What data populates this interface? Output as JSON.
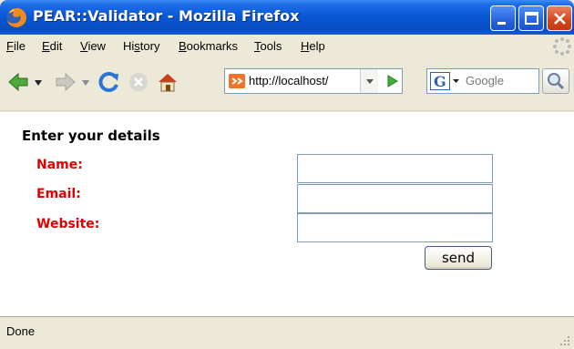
{
  "window": {
    "title": "PEAR::Validator - Mozilla Firefox"
  },
  "menu": [
    {
      "label": "File",
      "accel": "F",
      "rest": "ile"
    },
    {
      "label": "Edit",
      "accel": "E",
      "rest": "dit"
    },
    {
      "label": "View",
      "accel": "V",
      "rest": "iew"
    },
    {
      "label": "History",
      "pre": "Hi",
      "accel": "s",
      "rest": "tory"
    },
    {
      "label": "Bookmarks",
      "accel": "B",
      "rest": "ookmarks"
    },
    {
      "label": "Tools",
      "accel": "T",
      "rest": "ools"
    },
    {
      "label": "Help",
      "accel": "H",
      "rest": "elp"
    }
  ],
  "toolbar": {
    "url": "http://localhost/",
    "search_placeholder": "Google",
    "icons": [
      "back-icon",
      "forward-icon",
      "reload-icon",
      "stop-icon",
      "home-icon",
      "go-icon",
      "search-engine-icon",
      "magnifier-icon"
    ]
  },
  "form": {
    "heading": "Enter your details",
    "fields": [
      {
        "label": "Name:",
        "value": ""
      },
      {
        "label": "Email:",
        "value": ""
      },
      {
        "label": "Website:",
        "value": ""
      }
    ],
    "submit_label": "send",
    "label_color": "#e00000"
  },
  "status": {
    "text": "Done"
  }
}
